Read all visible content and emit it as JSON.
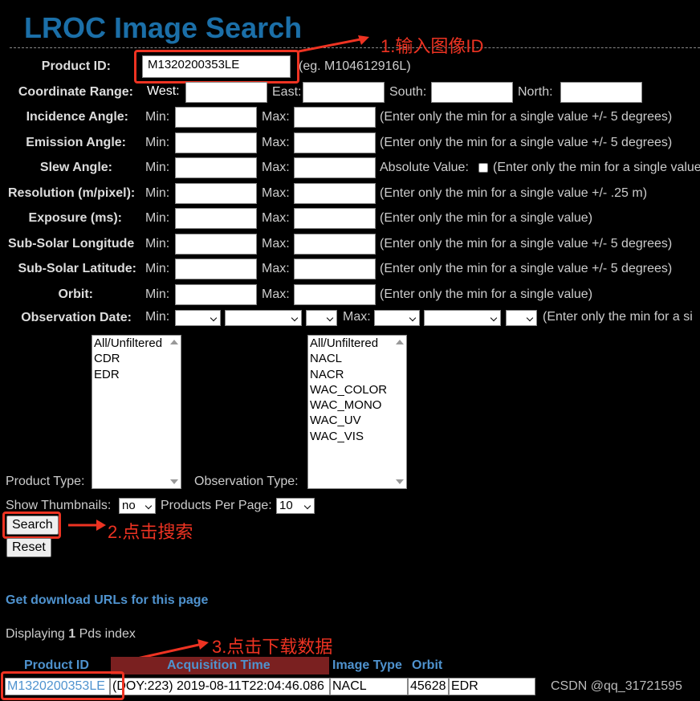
{
  "page_title": "LROC Image Search",
  "form": {
    "product_id": {
      "label": "Product ID:",
      "value": "M1320200353LE",
      "hint": "(eg. M104612916L)"
    },
    "coordinate_range": {
      "label": "Coordinate Range:",
      "west": "West:",
      "east": "East:",
      "south": "South:",
      "north": "North:"
    },
    "min_label": "Min:",
    "max_label": "Max:",
    "rows": [
      {
        "label": "Incidence Angle:",
        "hint": "(Enter only the min for a single value +/- 5 degrees)"
      },
      {
        "label": "Emission Angle:",
        "hint": "(Enter only the min for a single value +/- 5 degrees)"
      },
      {
        "label": "Slew Angle:",
        "extra": "Absolute Value:",
        "hint": "(Enter only the min for a single value"
      },
      {
        "label": "Resolution (m/pixel):",
        "hint": "(Enter only the min for a single value +/- .25 m)"
      },
      {
        "label": "Exposure (ms):",
        "hint": "(Enter only the min for a single value)"
      },
      {
        "label": "Sub-Solar Longitude",
        "hint": "(Enter only the min for a single value +/- 5 degrees)"
      },
      {
        "label": "Sub-Solar Latitude:",
        "hint": "(Enter only the min for a single value +/- 5 degrees)"
      },
      {
        "label": "Orbit:",
        "hint": "(Enter only the min for a single value)"
      }
    ],
    "observation_date": {
      "label": "Observation Date:",
      "min": "Min:",
      "max": "Max:",
      "hint": "(Enter only the min for a si"
    },
    "product_type": {
      "label": "Product Type:",
      "options": [
        "All/Unfiltered",
        "CDR",
        "EDR"
      ]
    },
    "observation_type": {
      "label": "Observation Type:",
      "options": [
        "All/Unfiltered",
        "NACL",
        "NACR",
        "WAC_COLOR",
        "WAC_MONO",
        "WAC_UV",
        "WAC_VIS"
      ]
    },
    "show_thumbnails": {
      "label": "Show Thumbnails:",
      "value": "no"
    },
    "products_per_page": {
      "label": "Products Per Page:",
      "value": "10"
    },
    "search_button": "Search",
    "reset_button": "Reset"
  },
  "annotations": {
    "step1": "1.输入图像ID",
    "step2": "2.点击搜索",
    "step3": "3.点击下载数据"
  },
  "results": {
    "download_link": "Get download URLs for this page",
    "displaying_prefix": "Displaying",
    "displaying_count": "1",
    "displaying_suffix": "Pds index",
    "columns": [
      "Product ID",
      "Acquisition Time",
      "Image Type",
      "Orbit"
    ],
    "row": {
      "product_id": "M1320200353LE",
      "acquisition_time": "(DOY:223) 2019-08-11T22:04:46.086",
      "image_type": "NACL",
      "orbit": "45628",
      "product_type": "EDR"
    }
  },
  "watermark": "CSDN @qq_31721595",
  "colors": {
    "title": "#1b6fa8",
    "annotation": "#ee3322",
    "link": "#4f93cf",
    "header_highlight": "#7a2020"
  }
}
